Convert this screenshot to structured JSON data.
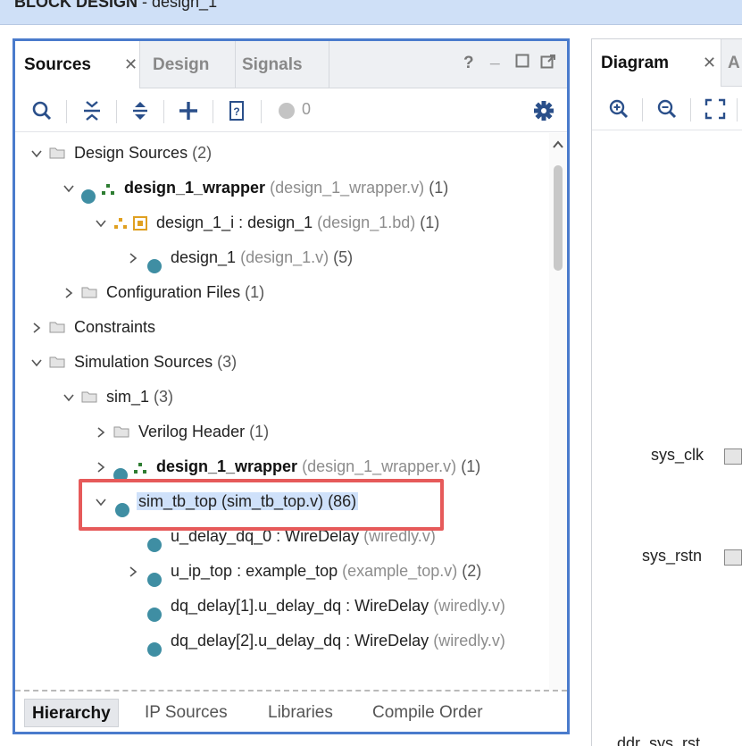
{
  "window": {
    "title_bold": "BLOCK DESIGN",
    "title_rest": " - design_1"
  },
  "sources_panel": {
    "tabs": [
      {
        "label": "Sources"
      },
      {
        "label": "Design"
      },
      {
        "label": "Signals"
      }
    ],
    "window_controls": {
      "help": "?",
      "minimize": "_"
    },
    "toolbar": {
      "warning_count": "0"
    },
    "tree": [
      {
        "label": "Design Sources",
        "count": "(2)"
      },
      {
        "label": "design_1_wrapper",
        "file": "(design_1_wrapper.v)",
        "count": "(1)"
      },
      {
        "label": "design_1_i : design_1",
        "file": "(design_1.bd)",
        "count": "(1)"
      },
      {
        "label": "design_1",
        "file": "(design_1.v)",
        "count": "(5)"
      },
      {
        "label": "Configuration Files",
        "count": "(1)"
      },
      {
        "label": "Constraints"
      },
      {
        "label": "Simulation Sources",
        "count": "(3)"
      },
      {
        "label": "sim_1",
        "count": "(3)"
      },
      {
        "label": "Verilog Header",
        "count": "(1)"
      },
      {
        "label": "design_1_wrapper",
        "file": "(design_1_wrapper.v)",
        "count": "(1)"
      },
      {
        "label": "sim_tb_top (sim_tb_top.v) (86)"
      },
      {
        "label": "u_delay_dq_0 : WireDelay",
        "file": "(wiredly.v)"
      },
      {
        "label": "u_ip_top : example_top",
        "file": "(example_top.v)",
        "count": "(2)"
      },
      {
        "label": "dq_delay[1].u_delay_dq : WireDelay",
        "file": "(wiredly.v)"
      },
      {
        "label": "dq_delay[2].u_delay_dq : WireDelay",
        "file": "(wiredly.v)"
      }
    ],
    "bottom_tabs": [
      {
        "label": "Hierarchy"
      },
      {
        "label": "IP Sources"
      },
      {
        "label": "Libraries"
      },
      {
        "label": "Compile Order"
      }
    ]
  },
  "diagram_panel": {
    "tab_label": "Diagram",
    "next_tab_label": "A",
    "ports": [
      {
        "label": "sys_clk"
      },
      {
        "label": "sys_rstn"
      },
      {
        "label": "ddr_sys_rst"
      }
    ]
  },
  "colors": {
    "accent": "#4a7bcc",
    "highlight": "#cfe1fa",
    "annotation": "#e65a5a",
    "source_dot": "#3f8ea3"
  }
}
